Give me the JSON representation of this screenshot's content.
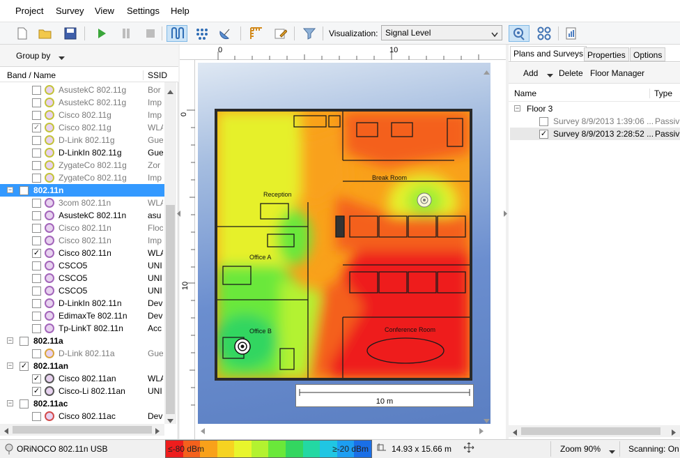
{
  "menu": [
    "Project",
    "Survey",
    "View",
    "Settings",
    "Help"
  ],
  "toolbar": {
    "icons": [
      "new-file-icon",
      "open-folder-icon",
      "save-icon",
      "play-icon",
      "pause-icon",
      "stop-icon",
      "survey-mode-icon",
      "grid-points-icon",
      "satellite-dish-icon",
      "calibrate-icon",
      "edit-icon",
      "filter-icon"
    ],
    "visualization_label": "Visualization:",
    "visualization_value": "Signal Level"
  },
  "left_panel": {
    "group_by": "Group by",
    "col_name": "Band / Name",
    "col_ssid": "SSID",
    "rows": [
      {
        "type": "item",
        "name": "AsustekC 802.11g",
        "ssid": "Bor",
        "checked": false,
        "dim": true,
        "color": "#c4c43a"
      },
      {
        "type": "item",
        "name": "AsustekC 802.11g",
        "ssid": "Imp",
        "checked": false,
        "dim": true,
        "color": "#c4c43a"
      },
      {
        "type": "item",
        "name": "Cisco 802.11g",
        "ssid": "Imp",
        "checked": false,
        "dim": true,
        "color": "#c4c43a"
      },
      {
        "type": "item",
        "name": "Cisco 802.11g",
        "ssid": "WLA",
        "checked": true,
        "dim": true,
        "color": "#c4c43a"
      },
      {
        "type": "item",
        "name": "D-Link 802.11g",
        "ssid": "Gue",
        "checked": false,
        "dim": true,
        "color": "#c4c43a"
      },
      {
        "type": "item",
        "name": "D-LinkIn 802.11g",
        "ssid": "Gue",
        "checked": false,
        "dim": false,
        "color": "#c4c43a"
      },
      {
        "type": "item",
        "name": "ZygateCo 802.11g",
        "ssid": "Zor",
        "checked": false,
        "dim": true,
        "color": "#c4c43a"
      },
      {
        "type": "item",
        "name": "ZygateCo 802.11g",
        "ssid": "Imp",
        "checked": false,
        "dim": true,
        "color": "#c4c43a"
      },
      {
        "type": "group",
        "name": "802.11n",
        "checked": true,
        "selected": true,
        "expanded": true
      },
      {
        "type": "item",
        "name": "3com 802.11n",
        "ssid": "WLA",
        "checked": false,
        "dim": true,
        "color": "#a365ba"
      },
      {
        "type": "item",
        "name": "AsustekC 802.11n",
        "ssid": "asu",
        "checked": false,
        "dim": false,
        "color": "#a365ba"
      },
      {
        "type": "item",
        "name": "Cisco 802.11n",
        "ssid": "Floc",
        "checked": false,
        "dim": true,
        "color": "#a365ba"
      },
      {
        "type": "item",
        "name": "Cisco 802.11n",
        "ssid": "Imp",
        "checked": false,
        "dim": true,
        "color": "#a365ba"
      },
      {
        "type": "item",
        "name": "Cisco 802.11n",
        "ssid": "WLA",
        "checked": true,
        "dim": false,
        "color": "#a365ba"
      },
      {
        "type": "item",
        "name": "CSCO5",
        "ssid": "UNI",
        "checked": false,
        "dim": false,
        "color": "#a365ba"
      },
      {
        "type": "item",
        "name": "CSCO5",
        "ssid": "UNI",
        "checked": false,
        "dim": false,
        "color": "#a365ba"
      },
      {
        "type": "item",
        "name": "CSCO5",
        "ssid": "UNI",
        "checked": false,
        "dim": false,
        "color": "#a365ba"
      },
      {
        "type": "item",
        "name": "D-LinkIn 802.11n",
        "ssid": "Dev",
        "checked": false,
        "dim": false,
        "color": "#a365ba"
      },
      {
        "type": "item",
        "name": "EdimaxTe 802.11n",
        "ssid": "Dev",
        "checked": false,
        "dim": false,
        "color": "#a365ba"
      },
      {
        "type": "item",
        "name": "Tp-LinkT 802.11n",
        "ssid": "Acc",
        "checked": false,
        "dim": false,
        "color": "#a365ba"
      },
      {
        "type": "group",
        "name": "802.11a",
        "checked": false,
        "selected": false,
        "expanded": true
      },
      {
        "type": "item",
        "name": "D-Link 802.11a",
        "ssid": "Gue",
        "checked": false,
        "dim": true,
        "color": "#d9a43b"
      },
      {
        "type": "group",
        "name": "802.11an",
        "checked": true,
        "selected": false,
        "expanded": true
      },
      {
        "type": "item",
        "name": "Cisco 802.11an",
        "ssid": "WLA",
        "checked": true,
        "dim": false,
        "color": "#555555"
      },
      {
        "type": "item",
        "name": "Cisco-Li 802.11an",
        "ssid": "UNI",
        "checked": true,
        "dim": false,
        "color": "#555555"
      },
      {
        "type": "group",
        "name": "802.11ac",
        "checked": false,
        "selected": false,
        "expanded": true
      },
      {
        "type": "item",
        "name": "Cisco 802.11ac",
        "ssid": "Dev",
        "checked": false,
        "dim": false,
        "color": "#d24a4a"
      }
    ]
  },
  "center": {
    "ruler_h_labels": [
      "0",
      "10"
    ],
    "ruler_v_labels": [
      "0",
      "10"
    ],
    "rooms": [
      "Reception",
      "Office A",
      "Office B",
      "Break Room",
      "Conference Room"
    ],
    "scale_label": "10 m"
  },
  "right_panel": {
    "tabs": [
      "Plans and Surveys",
      "Properties",
      "Options"
    ],
    "actions": [
      "Add",
      "Delete",
      "Floor Manager"
    ],
    "col_name": "Name",
    "col_type": "Type",
    "floor": "Floor 3",
    "surveys": [
      {
        "name": "Survey 8/9/2013 1:39:06 ...",
        "type": "Passiv",
        "checked": false,
        "dim": true,
        "selected": false
      },
      {
        "name": "Survey 8/9/2013 2:28:52 ...",
        "type": "Passiv",
        "checked": true,
        "dim": false,
        "selected": true
      }
    ]
  },
  "status": {
    "adapter": "ORiNOCO 802.11n USB",
    "legend_min": "≤-80 dBm",
    "legend_max": "≥-20 dBm",
    "legend_colors": [
      "#ee1d1d",
      "#f4611d",
      "#f9a11a",
      "#f6d321",
      "#e8f52c",
      "#b3f230",
      "#6ae83a",
      "#33d660",
      "#23d8a3",
      "#20c6e3",
      "#1d9ef2",
      "#1a6fe7"
    ],
    "dimensions": "14.93 x 15.66 m",
    "zoom": "Zoom 90%",
    "scanning": "Scanning: On"
  }
}
